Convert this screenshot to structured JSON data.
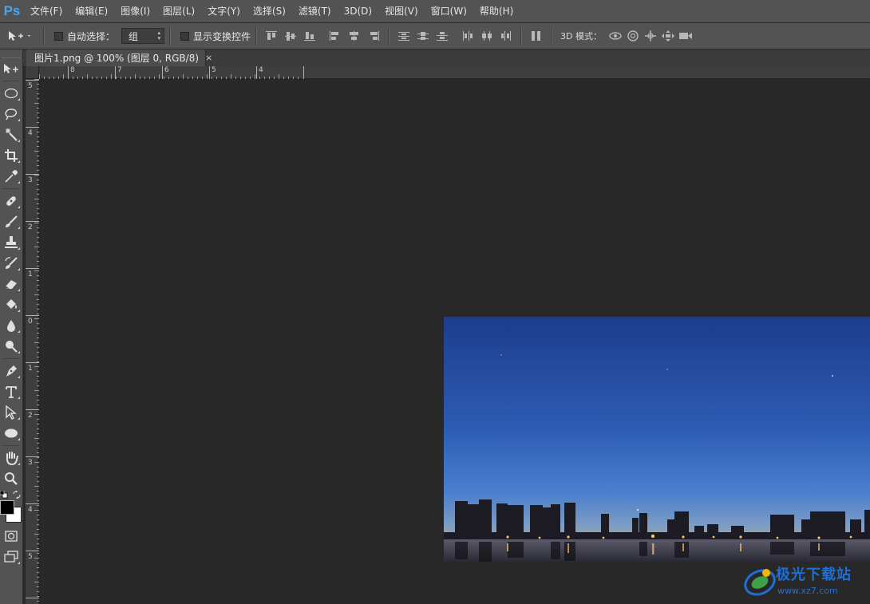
{
  "app": {
    "logo": "Ps"
  },
  "menu": [
    "文件(F)",
    "编辑(E)",
    "图像(I)",
    "图层(L)",
    "文字(Y)",
    "选择(S)",
    "滤镜(T)",
    "3D(D)",
    "视图(V)",
    "窗口(W)",
    "帮助(H)"
  ],
  "options": {
    "auto_select_label": "自动选择：",
    "auto_select_value": "组",
    "show_transform_label": "显示变换控件",
    "mode_3d_label": "3D 模式："
  },
  "document": {
    "tab_title": "图片1.png @ 100% (图层 0, RGB/8)",
    "close_glyph": "×"
  },
  "ruler": {
    "horizontal": [
      "8",
      "7",
      "6",
      "5",
      "4"
    ],
    "vertical": [
      "5",
      "4",
      "3",
      "2",
      "1",
      "0",
      "1",
      "2",
      "3",
      "4",
      "5"
    ]
  },
  "watermark": {
    "name": "极光下载站",
    "url": "www.xz7.com"
  },
  "colors": {
    "chrome": "#535353",
    "workspace": "#282828",
    "ps_blue": "#4fa3e8"
  }
}
